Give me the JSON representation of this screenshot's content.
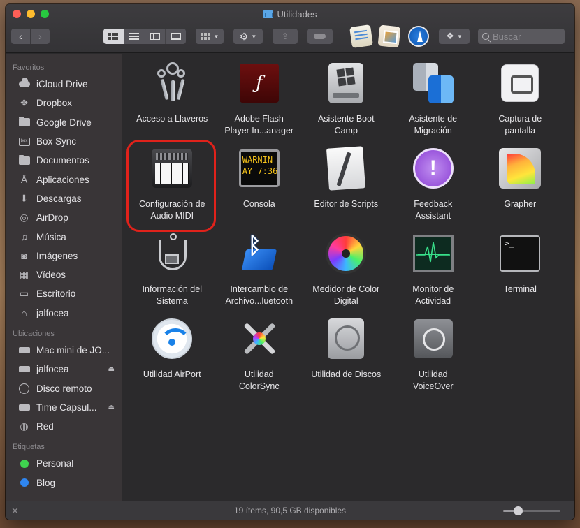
{
  "window": {
    "title": "Utilidades"
  },
  "toolbar": {
    "back": "‹",
    "forward": "›",
    "search_placeholder": "Buscar"
  },
  "sidebar": {
    "sections": [
      {
        "title": "Favoritos",
        "items": [
          {
            "label": "iCloud Drive",
            "icon": "cloud-icon"
          },
          {
            "label": "Dropbox",
            "icon": "dropbox-icon"
          },
          {
            "label": "Google Drive",
            "icon": "folder-icon"
          },
          {
            "label": "Box Sync",
            "icon": "box-icon"
          },
          {
            "label": "Documentos",
            "icon": "document-icon"
          },
          {
            "label": "Aplicaciones",
            "icon": "applications-icon"
          },
          {
            "label": "Descargas",
            "icon": "downloads-icon"
          },
          {
            "label": "AirDrop",
            "icon": "airdrop-icon"
          },
          {
            "label": "Música",
            "icon": "music-icon"
          },
          {
            "label": "Imágenes",
            "icon": "camera-icon"
          },
          {
            "label": "Vídeos",
            "icon": "film-icon"
          },
          {
            "label": "Escritorio",
            "icon": "desktop-icon"
          },
          {
            "label": "jalfocea",
            "icon": "home-icon"
          }
        ]
      },
      {
        "title": "Ubicaciones",
        "items": [
          {
            "label": "Mac mini de JO...",
            "icon": "computer-icon",
            "eject": false
          },
          {
            "label": "jalfocea",
            "icon": "disk-icon",
            "eject": true
          },
          {
            "label": "Disco remoto",
            "icon": "disc-icon",
            "eject": false
          },
          {
            "label": "Time Capsul...",
            "icon": "disk-icon",
            "eject": true
          },
          {
            "label": "Red",
            "icon": "network-icon",
            "eject": false
          }
        ]
      },
      {
        "title": "Etiquetas",
        "items": [
          {
            "label": "Personal",
            "color": "#3fd24f"
          },
          {
            "label": "Blog",
            "color": "#2f86f0"
          }
        ]
      }
    ]
  },
  "items": [
    {
      "label": "Acceso a Llaveros",
      "icon": "keychain-icon"
    },
    {
      "label": "Adobe Flash\nPlayer In...anager",
      "icon": "flash-icon"
    },
    {
      "label": "Asistente Boot\nCamp",
      "icon": "bootcamp-icon"
    },
    {
      "label": "Asistente de\nMigración",
      "icon": "migration-icon"
    },
    {
      "label": "Captura de\npantalla",
      "icon": "screenshot-icon"
    },
    {
      "label": "Configuración de\nAudio MIDI",
      "icon": "midi-keyboard-icon",
      "selected": true
    },
    {
      "label": "Consola",
      "icon": "console-icon",
      "screen_text": "WARNIN\nAY 7:36"
    },
    {
      "label": "Editor de Scripts",
      "icon": "script-icon"
    },
    {
      "label": "Feedback\nAssistant",
      "icon": "feedback-icon",
      "glyph": "!"
    },
    {
      "label": "Grapher",
      "icon": "grapher-icon"
    },
    {
      "label": "Información del\nSistema",
      "icon": "system-info-icon"
    },
    {
      "label": "Intercambio de\nArchivo...luetooth",
      "icon": "bluetooth-icon",
      "glyph": "ᛒ"
    },
    {
      "label": "Medidor de Color\nDigital",
      "icon": "color-meter-icon"
    },
    {
      "label": "Monitor de\nActividad",
      "icon": "activity-monitor-icon"
    },
    {
      "label": "Terminal",
      "icon": "terminal-icon",
      "prompt": ">_"
    },
    {
      "label": "Utilidad AirPort",
      "icon": "airport-icon"
    },
    {
      "label": "Utilidad\nColorSync",
      "icon": "colorsync-icon"
    },
    {
      "label": "Utilidad de Discos",
      "icon": "disk-utility-icon"
    },
    {
      "label": "Utilidad\nVoiceOver",
      "icon": "voiceover-icon"
    }
  ],
  "status": {
    "text": "19 ítems, 90,5 GB disponibles",
    "icon_size_fraction": 0.25
  }
}
